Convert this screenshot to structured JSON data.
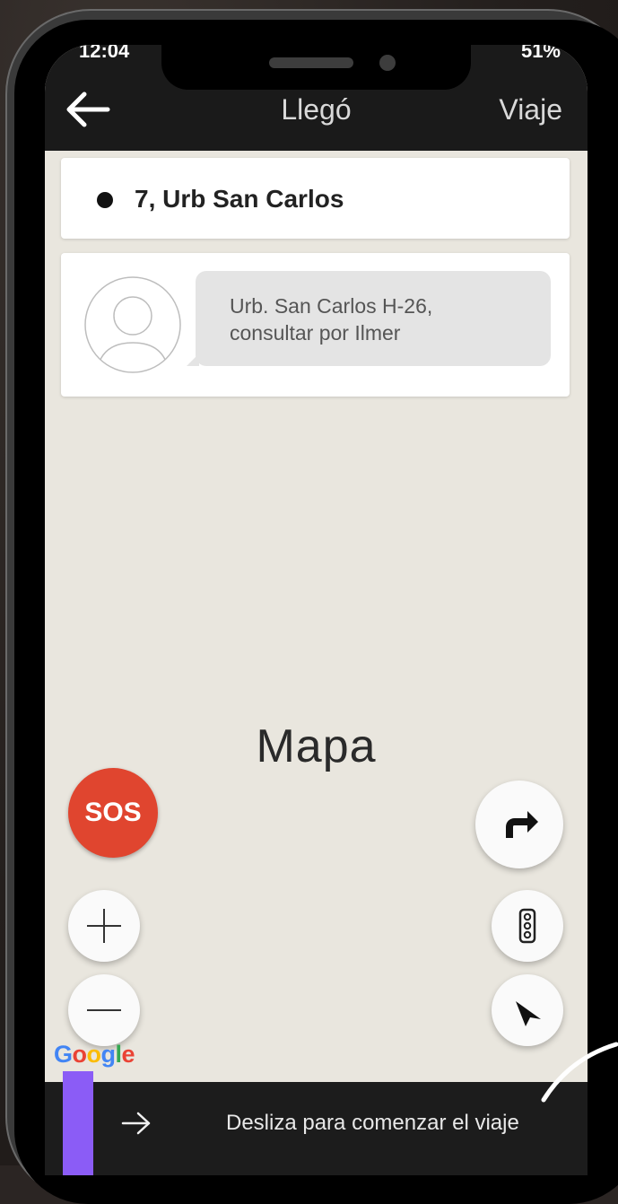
{
  "status_bar": {
    "time": "12:04",
    "battery": "51%"
  },
  "header": {
    "title": "Llegó",
    "right_action": "Viaje"
  },
  "address_card": {
    "address": "7, Urb San Carlos"
  },
  "note_card": {
    "message": "Urb. San Carlos H-26,\nconsultar por Ilmer"
  },
  "map": {
    "label": "Mapa",
    "attribution": "Google"
  },
  "sos_button": {
    "label": "SOS",
    "color": "#e0452f"
  },
  "controls": {
    "zoom_in_icon": "plus-icon",
    "zoom_out_icon": "minus-icon",
    "route_icon": "turn-right-arrow-icon",
    "traffic_icon": "traffic-light-icon",
    "locate_icon": "navigation-arrow-icon"
  },
  "slider": {
    "text": "Desliza para comenzar el viaje",
    "handle_color": "#8b5cf6",
    "arrow_icon": "right-arrow-icon"
  }
}
